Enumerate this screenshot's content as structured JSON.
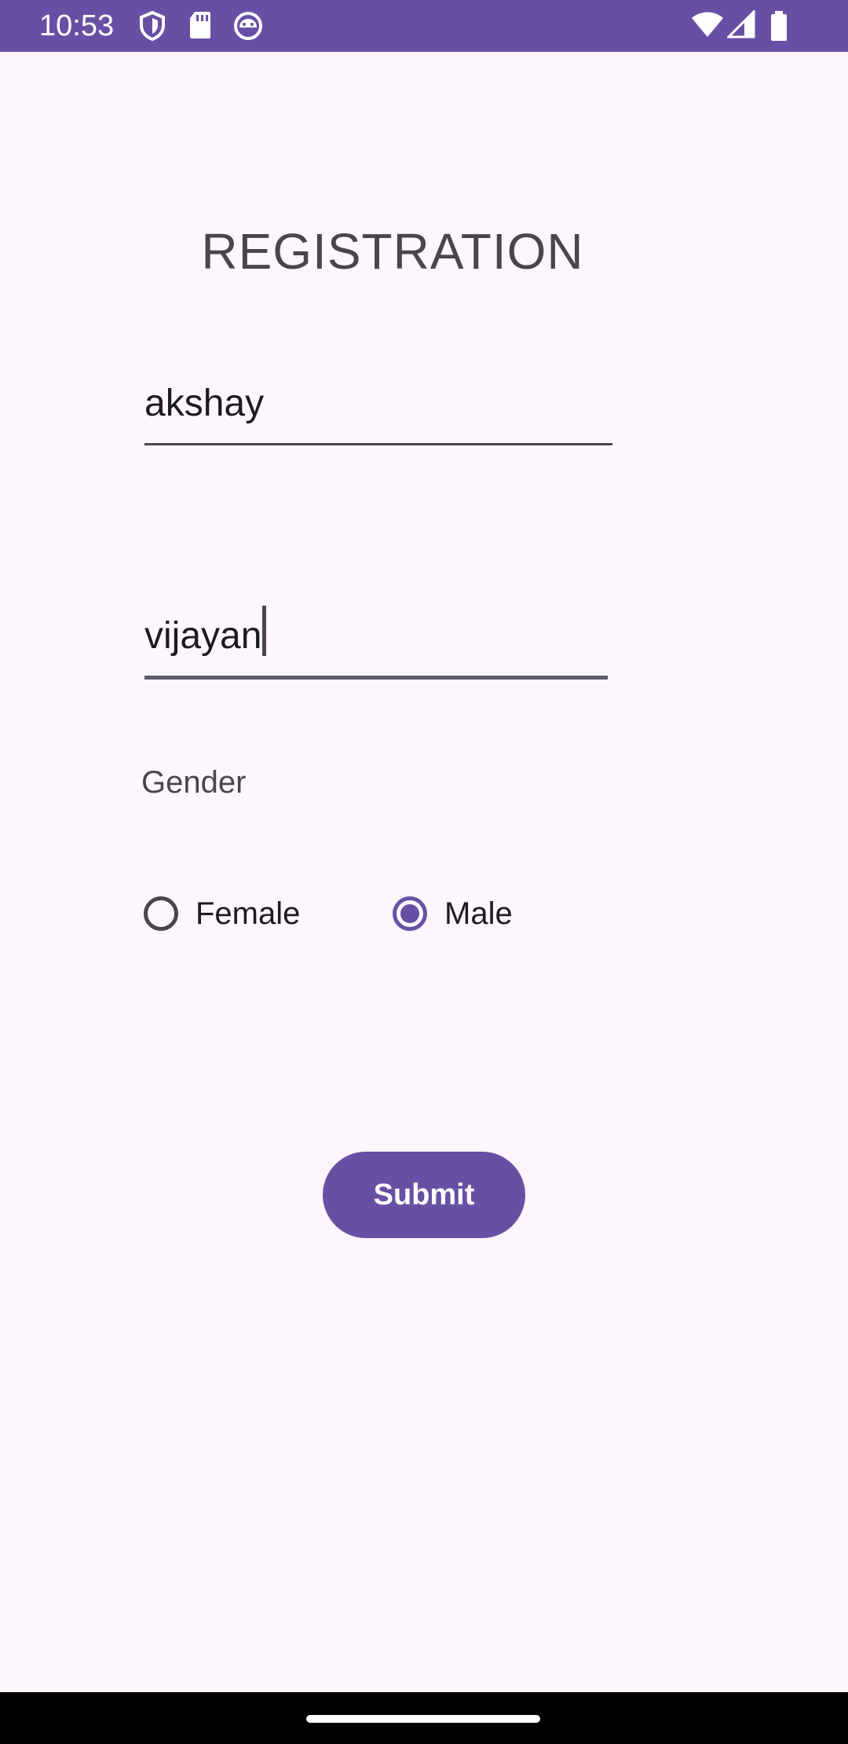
{
  "status_bar": {
    "time": "10:53",
    "icons": [
      "shield-icon",
      "sd-card-icon",
      "android-robot-icon",
      "wifi-icon",
      "cellular-signal-icon",
      "battery-icon"
    ],
    "background": "#6750a4"
  },
  "form": {
    "title": "REGISTRATION",
    "first_name_value": "akshay",
    "last_name_value": "vijayan",
    "gender_label": "Gender",
    "gender_options": [
      {
        "label": "Female",
        "checked": false
      },
      {
        "label": "Male",
        "checked": true
      }
    ],
    "submit_label": "Submit"
  },
  "colors": {
    "accent": "#6750a4",
    "background": "#fdf7fd",
    "text": "#49454f"
  }
}
